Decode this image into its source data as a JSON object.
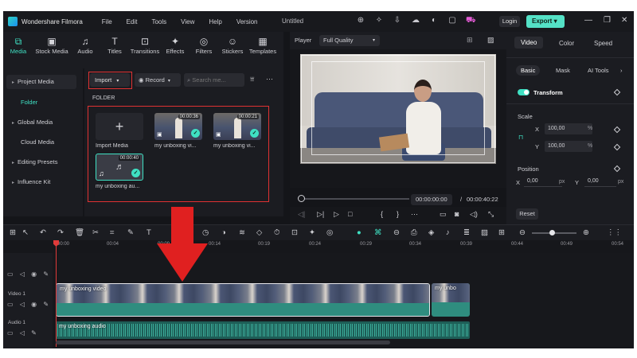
{
  "app": {
    "name": "Wondershare Filmora",
    "doc_title": "Untitled",
    "menu": [
      "File",
      "Edit",
      "Tools",
      "View",
      "Help",
      "Version"
    ],
    "login_label": "Login",
    "export_label": "Export",
    "export_caret": "▾"
  },
  "media_tabs": [
    {
      "label": "Media",
      "icon": "⧉"
    },
    {
      "label": "Stock Media",
      "icon": "▣"
    },
    {
      "label": "Audio",
      "icon": "♫"
    },
    {
      "label": "Titles",
      "icon": "T"
    },
    {
      "label": "Transitions",
      "icon": "⊡"
    },
    {
      "label": "Effects",
      "icon": "✦"
    },
    {
      "label": "Filters",
      "icon": "◎"
    },
    {
      "label": "Stickers",
      "icon": "☺"
    },
    {
      "label": "Templates",
      "icon": "▦"
    }
  ],
  "leftnav": {
    "items": [
      "Project Media",
      "Folder",
      "Global Media",
      "Cloud Media",
      "Editing Presets",
      "Influence Kit"
    ],
    "caret": "▸"
  },
  "library": {
    "import_label": "Import",
    "record_label": "Record",
    "search_placeholder": "Search me...",
    "folder_label": "FOLDER",
    "import_media_label": "Import Media",
    "items": [
      {
        "name": "my unboxing vi...",
        "duration": "00:00:36"
      },
      {
        "name": "my unboxing vi...",
        "duration": "00:00:21"
      },
      {
        "name": "my unboxing au...",
        "duration": "00:00:40"
      }
    ]
  },
  "player": {
    "label": "Player",
    "quality": "Full Quality",
    "current_time": "00:00:00:00",
    "separator": "/",
    "total_time": "00:00:40:22"
  },
  "properties": {
    "tabs": [
      "Video",
      "Color",
      "Speed"
    ],
    "subtabs": [
      "Basic",
      "Mask",
      "AI Tools"
    ],
    "transform_label": "Transform",
    "scale_label": "Scale",
    "scale_x_label": "X",
    "scale_x": "100,00",
    "scale_y_label": "Y",
    "scale_y": "100,00",
    "percent": "%",
    "position_label": "Position",
    "pos_x_label": "X",
    "pos_x": "0,00",
    "pos_y_label": "Y",
    "pos_y": "0,00",
    "px": "px",
    "reset_label": "Reset"
  },
  "timeline": {
    "ruler": [
      "00:00",
      "00:04",
      "00:09",
      "00:14",
      "00:19",
      "00:24",
      "00:29",
      "00:34",
      "00:39",
      "00:44",
      "00:49",
      "00:54"
    ],
    "video_track": "Video 1",
    "audio_track": "Audio 1",
    "video_clip_label": "my unboxing video",
    "video_clip2_label": "my unbo",
    "audio_clip_label": "my unboxing audio"
  },
  "colors": {
    "accent": "#3fe0c3",
    "highlight_red": "#e02020",
    "background": "#141519"
  }
}
